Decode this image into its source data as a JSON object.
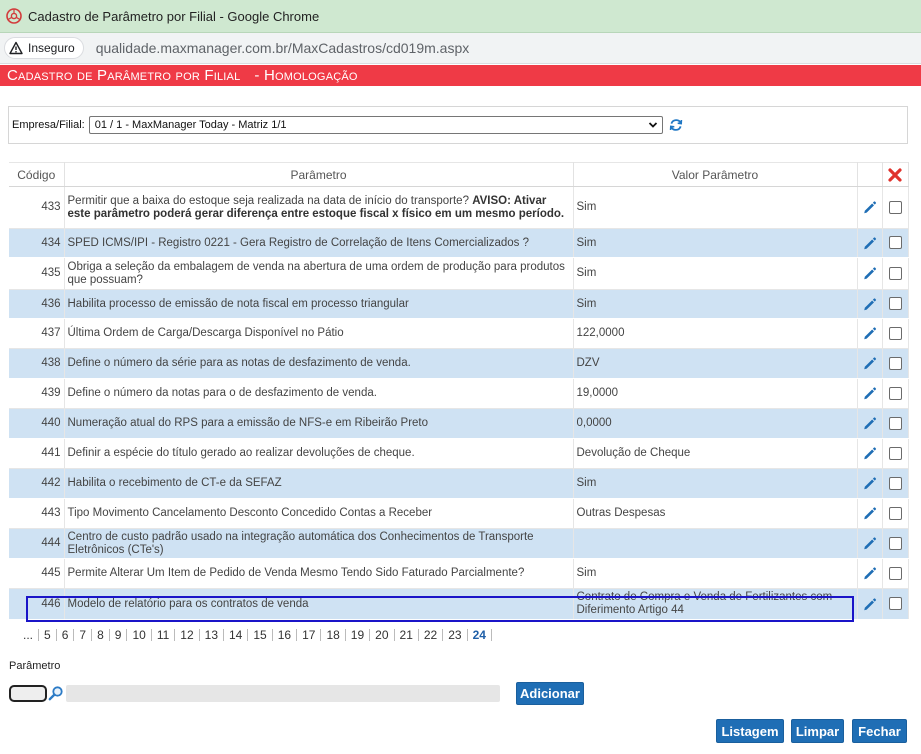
{
  "browser": {
    "window_title": "Cadastro de Parâmetro por Filial - Google Chrome",
    "security_label": "Inseguro",
    "url": "qualidade.maxmanager.com.br/MaxCadastros/cd019m.aspx"
  },
  "header": {
    "title": "Cadastro de Parâmetro por Filial",
    "environment": "- Homologação"
  },
  "filter": {
    "label": "Empresa/Filial:",
    "selected": "01 / 1 - MaxManager Today - Matriz 1/1"
  },
  "table": {
    "columns": [
      "Código",
      "Parâmetro",
      "Valor Parâmetro"
    ],
    "rows": [
      {
        "code": "433",
        "param": "Permitir que a baixa do estoque seja realizada na data de início do transporte?",
        "param_bold": "AVISO: Ativar este parâmetro poderá gerar diferença entre estoque fiscal x físico em um mesmo período.",
        "value": "Sim"
      },
      {
        "code": "434",
        "param": "SPED ICMS/IPI - Registro 0221 - Gera Registro de Correlação de Itens Comercializados ?",
        "param_bold": "",
        "value": "Sim"
      },
      {
        "code": "435",
        "param": "Obriga a seleção da embalagem de venda na abertura de uma ordem de produção para produtos que possuam?",
        "param_bold": "",
        "value": "Sim"
      },
      {
        "code": "436",
        "param": "Habilita processo de emissão de nota fiscal em processo triangular",
        "param_bold": "",
        "value": "Sim"
      },
      {
        "code": "437",
        "param": "Última Ordem de Carga/Descarga Disponível no Pátio",
        "param_bold": "",
        "value": "122,0000"
      },
      {
        "code": "438",
        "param": "Define o número da série para as notas de desfazimento de venda.",
        "param_bold": "",
        "value": "DZV"
      },
      {
        "code": "439",
        "param": "Define o número da notas para o de desfazimento de venda.",
        "param_bold": "",
        "value": "19,0000"
      },
      {
        "code": "440",
        "param": "Numeração atual do RPS para a emissão de NFS-e em Ribeirão Preto",
        "param_bold": "",
        "value": "0,0000"
      },
      {
        "code": "441",
        "param": "Definir a espécie do título gerado ao realizar devoluções de cheque.",
        "param_bold": "",
        "value": "Devolução de Cheque"
      },
      {
        "code": "442",
        "param": "Habilita o recebimento de CT-e da SEFAZ",
        "param_bold": "",
        "value": "Sim"
      },
      {
        "code": "443",
        "param": "Tipo Movimento Cancelamento Desconto Concedido Contas a Receber",
        "param_bold": "",
        "value": "Outras Despesas"
      },
      {
        "code": "444",
        "param": "Centro de custo padrão usado na integração automática dos Conhecimentos de Transporte Eletrônicos (CTe's)",
        "param_bold": "",
        "value": ""
      },
      {
        "code": "445",
        "param": "Permite Alterar Um Item de Pedido de Venda Mesmo Tendo Sido Faturado Parcialmente?",
        "param_bold": "",
        "value": "Sim"
      },
      {
        "code": "446",
        "param": "Modelo de relatório para os contratos de venda",
        "param_bold": "",
        "value": "Contrato de Compra e Venda de Fertilizantes com Diferimento Artigo 44"
      }
    ]
  },
  "pager": {
    "ellipsis": "...",
    "pages": [
      "5",
      "6",
      "7",
      "8",
      "9",
      "10",
      "11",
      "12",
      "13",
      "14",
      "15",
      "16",
      "17",
      "18",
      "19",
      "20",
      "21",
      "22",
      "23"
    ],
    "current": "24"
  },
  "form": {
    "param_label": "Parâmetro",
    "add_label": "Adicionar",
    "list_label": "Listagem",
    "clear_label": "Limpar",
    "close_label": "Fechar"
  },
  "colors": {
    "header_red": "#ef3a46",
    "row_alt": "#cfe2f3",
    "button_blue": "#1f6eb5",
    "selection_outline": "#1a14c8"
  }
}
